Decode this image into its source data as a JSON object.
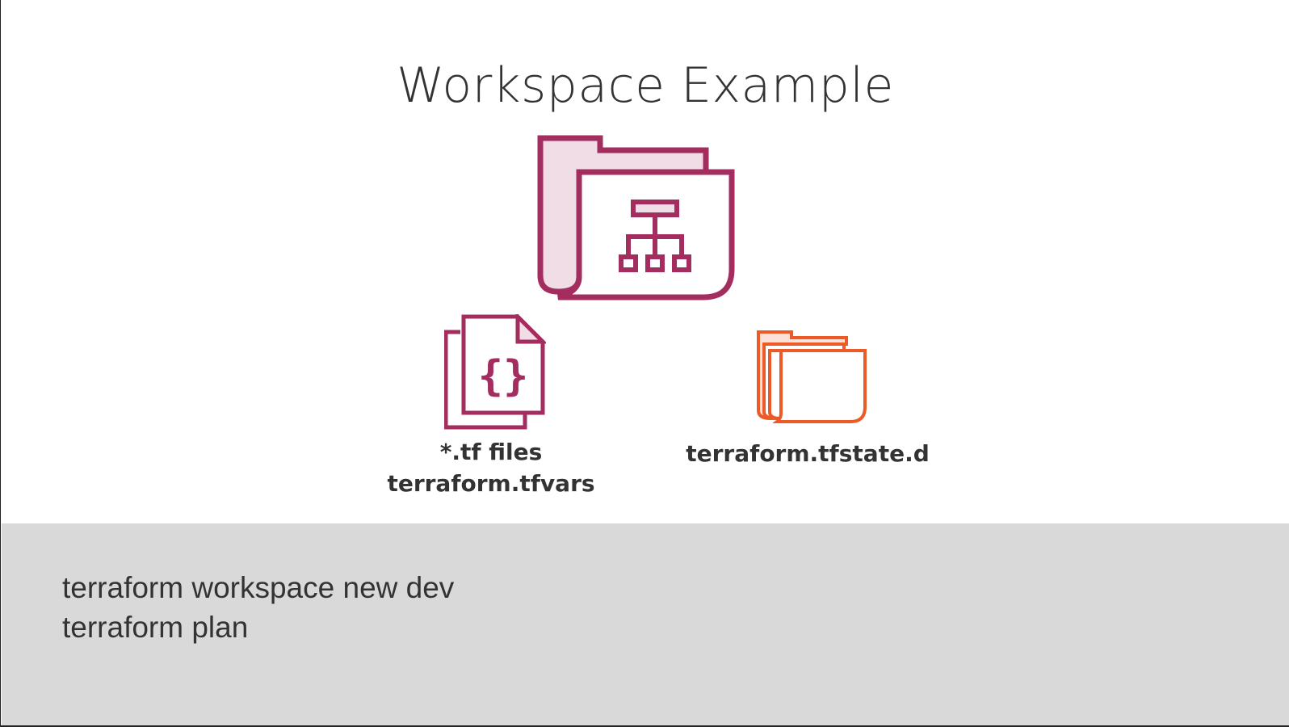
{
  "slide": {
    "title": "Workspace Example",
    "colors": {
      "primary_magenta": "#a32d5e",
      "light_magenta_fill": "#f1dde5",
      "accent_orange": "#ec5a28",
      "light_orange_fill": "#fbe1d8",
      "text": "#333333",
      "panel_background": "#d9d9d9"
    },
    "icons": {
      "workspace": "workspace-folder-hierarchy-icon",
      "config_files": "code-files-icon",
      "state": "stacked-folders-icon"
    },
    "labels": {
      "tf_files": "*.tf files",
      "tfvars": "terraform.tfvars",
      "tfstate": "terraform.tfstate.d"
    },
    "commands": [
      "terraform workspace new dev",
      "terraform plan"
    ]
  }
}
